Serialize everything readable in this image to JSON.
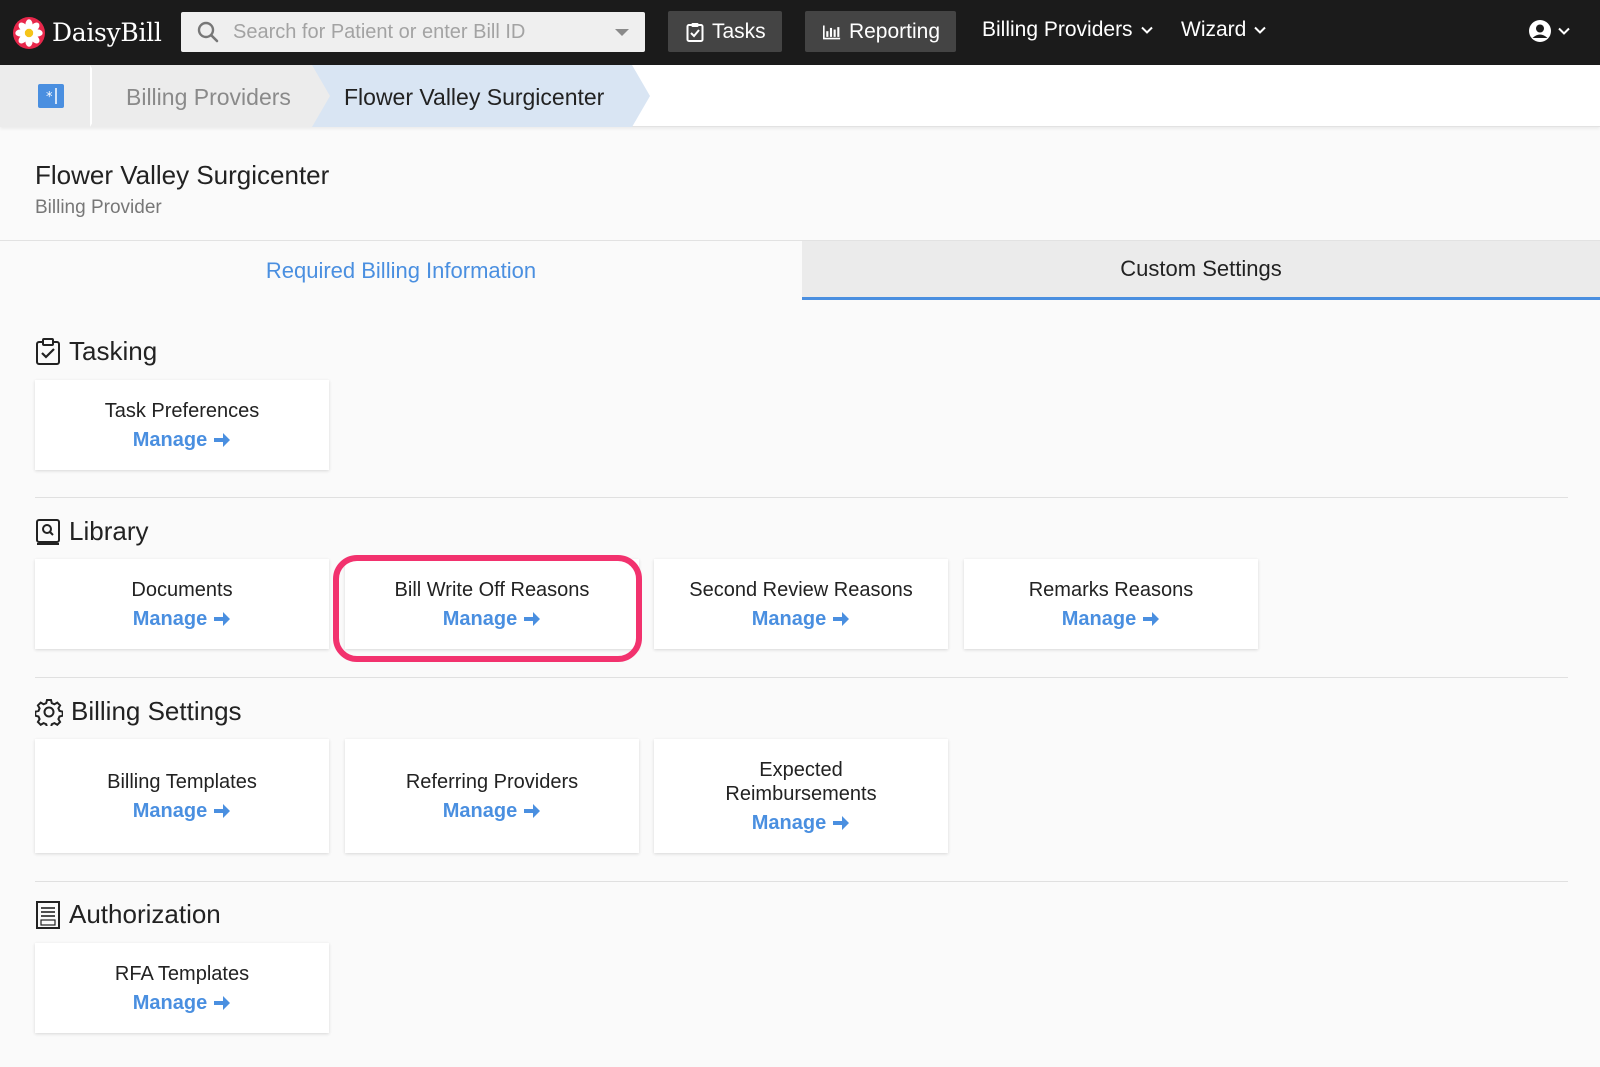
{
  "brand": {
    "name": "DaisyBill"
  },
  "search": {
    "placeholder": "Search for Patient or enter Bill ID"
  },
  "nav": {
    "tasks": "Tasks",
    "reporting": "Reporting",
    "billing_providers": "Billing Providers",
    "wizard": "Wizard"
  },
  "breadcrumb": {
    "items": [
      "Billing Providers",
      "Flower Valley Surgicenter"
    ]
  },
  "header": {
    "title": "Flower Valley Surgicenter",
    "subtitle": "Billing Provider"
  },
  "tabs": [
    {
      "label": "Required Billing Information",
      "active": false
    },
    {
      "label": "Custom Settings",
      "active": true
    }
  ],
  "sections": {
    "tasking": {
      "title": "Tasking",
      "cards": [
        {
          "label": "Task Preferences",
          "link": "Manage"
        }
      ]
    },
    "library": {
      "title": "Library",
      "cards": [
        {
          "label": "Documents",
          "link": "Manage"
        },
        {
          "label": "Bill Write Off Reasons",
          "link": "Manage"
        },
        {
          "label": "Second Review Reasons",
          "link": "Manage"
        },
        {
          "label": "Remarks Reasons",
          "link": "Manage"
        }
      ]
    },
    "billing_settings": {
      "title": "Billing Settings",
      "cards": [
        {
          "label": "Billing Templates",
          "link": "Manage"
        },
        {
          "label": "Referring Providers",
          "link": "Manage"
        },
        {
          "label": "Expected Reimbursements",
          "link": "Manage"
        }
      ]
    },
    "authorization": {
      "title": "Authorization",
      "cards": [
        {
          "label": "RFA Templates",
          "link": "Manage"
        }
      ]
    }
  },
  "colors": {
    "navbar": "#1b1b1b",
    "accent": "#4a8fe0",
    "highlight": "#f2326e",
    "breadcrumb_active": "#d9e5f3"
  }
}
